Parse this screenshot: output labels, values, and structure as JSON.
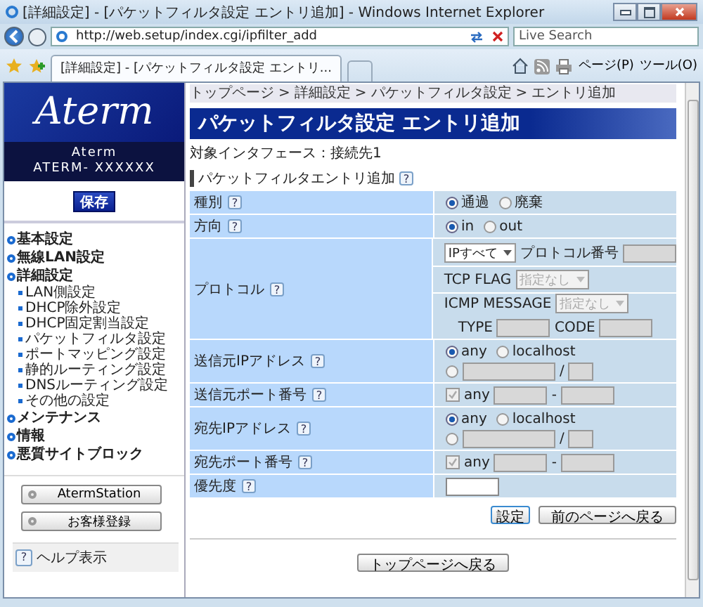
{
  "window": {
    "title": "[詳細設定] - [パケットフィルタ設定 エントリ追加] - Windows Internet Explorer"
  },
  "address_bar": {
    "url": "http://web.setup/index.cgi/ipfilter_add"
  },
  "search": {
    "placeholder": "Live Search"
  },
  "tabs": [
    {
      "label": "[詳細設定] - [パケットフィルタ設定 エントリ...",
      "selected": true
    }
  ],
  "toolbar": {
    "menus": [
      "ページ(P)",
      "ツール(O)"
    ]
  },
  "sidebar": {
    "logo": "Aterm",
    "model_lines": [
      "Aterm",
      "ATERM- XXXXXX"
    ],
    "save_button": "保存",
    "nav": [
      {
        "label": "基本設定"
      },
      {
        "label": "無線LAN設定"
      },
      {
        "label": "詳細設定",
        "children": [
          {
            "label": "LAN側設定"
          },
          {
            "label": "DHCP除外設定"
          },
          {
            "label": "DHCP固定割当設定"
          },
          {
            "label": "パケットフィルタ設定"
          },
          {
            "label": "ポートマッピング設定"
          },
          {
            "label": "静的ルーティング設定"
          },
          {
            "label": "DNSルーティング設定"
          },
          {
            "label": "その他の設定"
          }
        ]
      },
      {
        "label": "メンテナンス"
      },
      {
        "label": "情報"
      },
      {
        "label": "悪質サイトブロック"
      }
    ],
    "buttons": [
      "AtermStation",
      "お客様登録"
    ],
    "help": "ヘルプ表示"
  },
  "breadcrumb": {
    "items": [
      "トップページ",
      "詳細設定",
      "パケットフィルタ設定",
      "エントリ追加"
    ],
    "separator": ">"
  },
  "page_title": "パケットフィルタ設定 エントリ追加",
  "interface_line": "対象インタフェース：接続先1",
  "section_title": "パケットフィルタエントリ追加",
  "help_glyph": "?",
  "form": {
    "rows": [
      {
        "label": "種別",
        "kind": "radio",
        "options": [
          {
            "label": "通過",
            "selected": true
          },
          {
            "label": "廃棄",
            "selected": false
          }
        ]
      },
      {
        "label": "方向",
        "kind": "radio",
        "options": [
          {
            "label": "in",
            "selected": true
          },
          {
            "label": "out",
            "selected": false
          }
        ]
      },
      {
        "label": "プロトコル",
        "kind": "protocol",
        "protocol": "IPすべて",
        "number_label": "プロトコル番号",
        "number_disabled": true,
        "tcp_flag": {
          "label": "TCP FLAG",
          "value": "指定なし",
          "disabled": true
        },
        "icmp": {
          "label": "ICMP MESSAGE",
          "value": "指定なし",
          "disabled": true
        },
        "type_label": "TYPE",
        "code_label": "CODE"
      },
      {
        "label": "送信元IPアドレス",
        "kind": "address",
        "options": [
          {
            "label": "any",
            "selected": true
          },
          {
            "label": "localhost",
            "selected": false
          }
        ],
        "custom": {
          "selected": false,
          "separator": "/"
        }
      },
      {
        "label": "送信元ポート番号",
        "kind": "port",
        "any": {
          "label": "any",
          "checked": true,
          "disabled": true
        },
        "separator": "-"
      },
      {
        "label": "宛先IPアドレス",
        "kind": "address",
        "options": [
          {
            "label": "any",
            "selected": true
          },
          {
            "label": "localhost",
            "selected": false
          }
        ],
        "custom": {
          "selected": false,
          "separator": "/"
        }
      },
      {
        "label": "宛先ポート番号",
        "kind": "port",
        "any": {
          "label": "any",
          "checked": true,
          "disabled": true
        },
        "separator": "-"
      },
      {
        "label": "優先度",
        "kind": "text"
      }
    ]
  },
  "actions": [
    "設定",
    "前のページへ戻る"
  ],
  "footer_button": "トップページへ戻る"
}
